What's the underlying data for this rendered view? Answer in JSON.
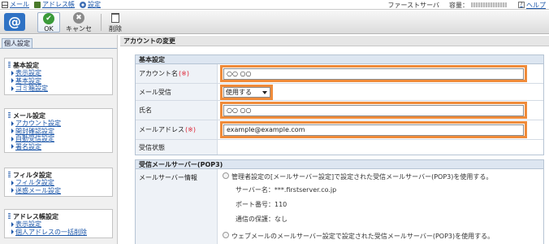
{
  "topnav": {
    "mail": "メール",
    "addressbook": "アドレス帳",
    "settings": "設定",
    "server": "ファーストサーバ",
    "capacity_label": "容量：",
    "help": "ヘルプ",
    "help_mark": "?"
  },
  "toolbar": {
    "logo": "@",
    "ok": "OK",
    "ok_mark": "✔",
    "cancel": "キャンセル",
    "cancel_mark": "✖",
    "delete": "削除"
  },
  "sidebar": {
    "tab": "個人設定",
    "groups": [
      {
        "title": "基本設定",
        "items": [
          "表示設定",
          "基本設定",
          "ゴミ箱設定"
        ]
      },
      {
        "title": "メール設定",
        "items": [
          "アカウント設定",
          "開封確認設定",
          "自動受信設定",
          "署名設定"
        ]
      },
      {
        "title": "フィルタ設定",
        "items": [
          "フィルタ設定",
          "迷惑メール設定"
        ]
      },
      {
        "title": "アドレス帳設定",
        "items": [
          "表示設定",
          "個人アドレスの一括削除"
        ]
      }
    ]
  },
  "main": {
    "title": "アカウントの変更",
    "basic": {
      "header": "基本設定",
      "account_label": "アカウント名",
      "account_value": "○○ ○○",
      "required_mark": "(※)",
      "receive_label": "メール受信",
      "receive_selected": "使用する",
      "name_label": "氏名",
      "name_value": "○○ ○○",
      "email_label": "メールアドレス",
      "email_value": "example@example.com",
      "status_label": "受信状態"
    },
    "server": {
      "header": "受信メールサーバー(POP3)",
      "info_label": "メールサーバー情報",
      "option1": "管理者設定の[メールサーバー設定]で設定された受信メールサーバー(POP3)を使用する。",
      "server_name": "サーバー名：***.firstserver.co.jp",
      "port": "ポート番号：110",
      "security": "通信の保護：なし",
      "option2": "ウェブメールのメールサーバー設定で設定された受信メールサーバー(POP3)を使用する。"
    }
  },
  "colors": {
    "highlight": "#ef8b3a",
    "link": "#1a55a8",
    "required": "#dd2233",
    "section_head": "#dde6f1"
  }
}
